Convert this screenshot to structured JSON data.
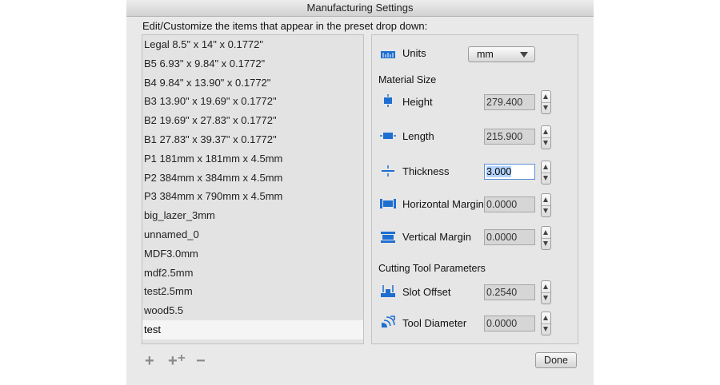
{
  "window": {
    "title": "Manufacturing Settings"
  },
  "instructions": "Edit/Customize the items that appear in the preset drop down:",
  "presets": [
    "Legal 8.5\" x 14\" x 0.1772\"",
    "B5 6.93\" x 9.84\" x 0.1772\"",
    "B4 9.84\" x 13.90\" x 0.1772\"",
    "B3 13.90\" x 19.69\" x 0.1772\"",
    "B2 19.69\" x 27.83\" x 0.1772\"",
    "B1 27.83\" x 39.37\" x 0.1772\"",
    "P1 181mm x 181mm x 4.5mm",
    "P2 384mm x 384mm x 4.5mm",
    "P3 384mm x 790mm x 4.5mm",
    "big_lazer_3mm",
    "unnamed_0",
    "MDF3.0mm",
    "mdf2.5mm",
    "test2.5mm",
    "wood5.5",
    "test"
  ],
  "selected_preset": "test",
  "units": {
    "label": "Units",
    "value": "mm",
    "icon": "ruler-icon"
  },
  "material_size": {
    "heading": "Material Size",
    "height": {
      "label": "Height",
      "value": "279.400",
      "icon": "height-icon"
    },
    "length": {
      "label": "Length",
      "value": "215.900",
      "icon": "length-icon"
    },
    "thickness": {
      "label": "Thickness",
      "value": "3.000",
      "icon": "thickness-icon"
    },
    "horizontal_margin": {
      "label": "Horizontal Margin",
      "value": "0.0000",
      "icon": "horizontal-margin-icon"
    },
    "vertical_margin": {
      "label": "Vertical Margin",
      "value": "0.0000",
      "icon": "vertical-margin-icon"
    }
  },
  "cutting_tool": {
    "heading": "Cutting Tool Parameters",
    "slot_offset": {
      "label": "Slot  Offset",
      "value": "0.2540",
      "icon": "slot-offset-icon"
    },
    "tool_diameter": {
      "label": "Tool Diameter",
      "value": "0.0000",
      "icon": "tool-diameter-icon"
    }
  },
  "toolbar": {
    "add_label": "+",
    "duplicate_label": "+⁺",
    "remove_label": "−"
  },
  "done_label": "Done",
  "colors": {
    "icon_blue": "#1f6fd1",
    "selection": "#b3d4fc"
  }
}
